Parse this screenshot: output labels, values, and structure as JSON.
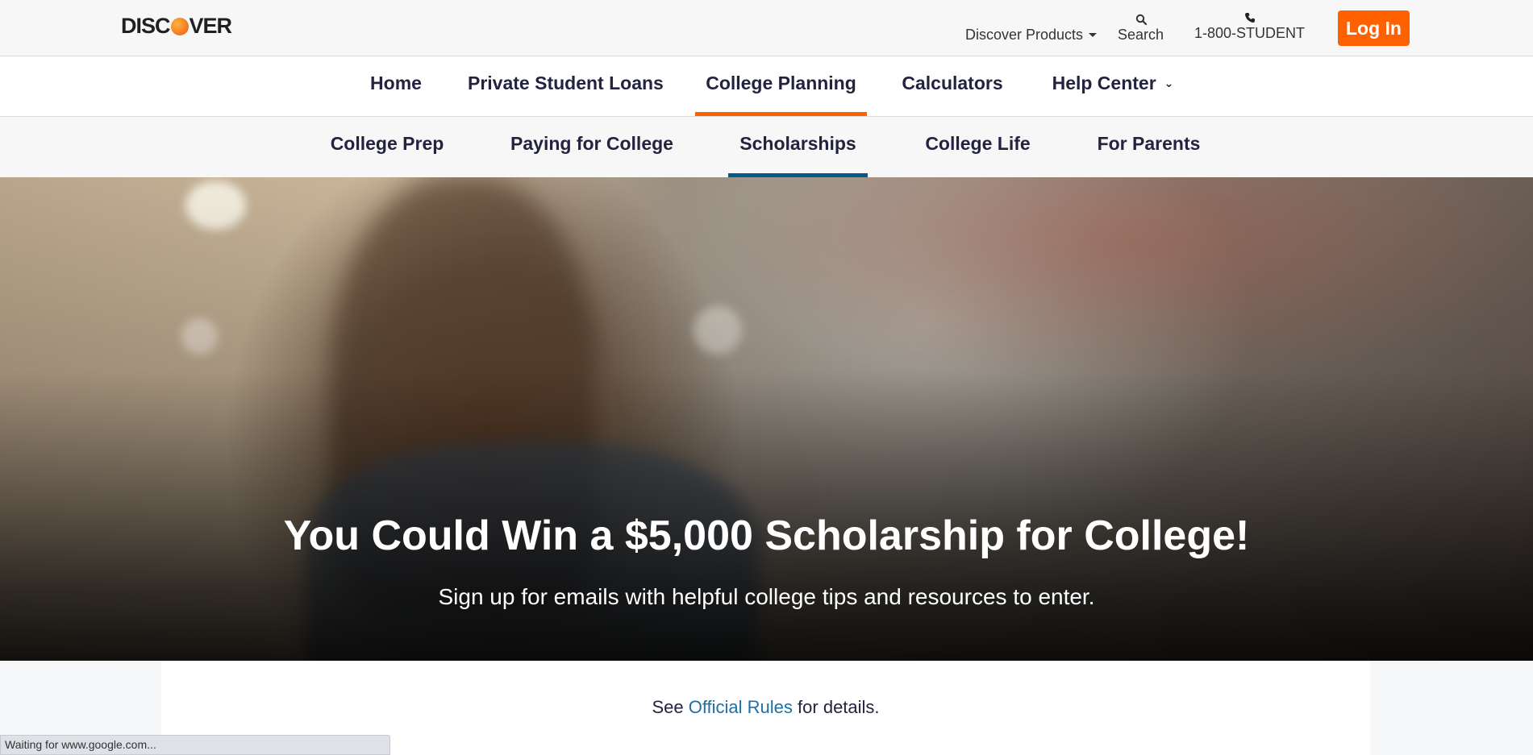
{
  "header": {
    "logo_before": "DISC",
    "logo_after": "VER",
    "products_label": "Discover Products",
    "search_label": "Search",
    "phone_label": "1-800-STUDENT",
    "login_label": "Log In"
  },
  "main_nav": {
    "items": [
      {
        "label": "Home"
      },
      {
        "label": "Private Student Loans"
      },
      {
        "label": "College Planning",
        "active": true
      },
      {
        "label": "Calculators"
      },
      {
        "label": "Help Center",
        "has_dropdown": true
      }
    ]
  },
  "sub_nav": {
    "items": [
      {
        "label": "College Prep"
      },
      {
        "label": "Paying for College"
      },
      {
        "label": "Scholarships",
        "active": true
      },
      {
        "label": "College Life"
      },
      {
        "label": "For Parents"
      }
    ]
  },
  "hero": {
    "title": "You Could Win a $5,000 Scholarship for College!",
    "subtitle": "Sign up for emails with helpful college tips and resources to enter."
  },
  "content": {
    "rules_prefix": "See",
    "rules_link": "Official Rules",
    "rules_suffix": "for details."
  },
  "browser_status": {
    "text": "Waiting for www.google.com..."
  },
  "colors": {
    "accent_orange": "#ff6000",
    "subnav_active": "#005a8c",
    "link_blue": "#1d6fa5",
    "text_dark": "#23233f"
  },
  "icons": [
    "search-icon",
    "phone-icon",
    "caret-down-icon",
    "chevron-down-icon"
  ]
}
